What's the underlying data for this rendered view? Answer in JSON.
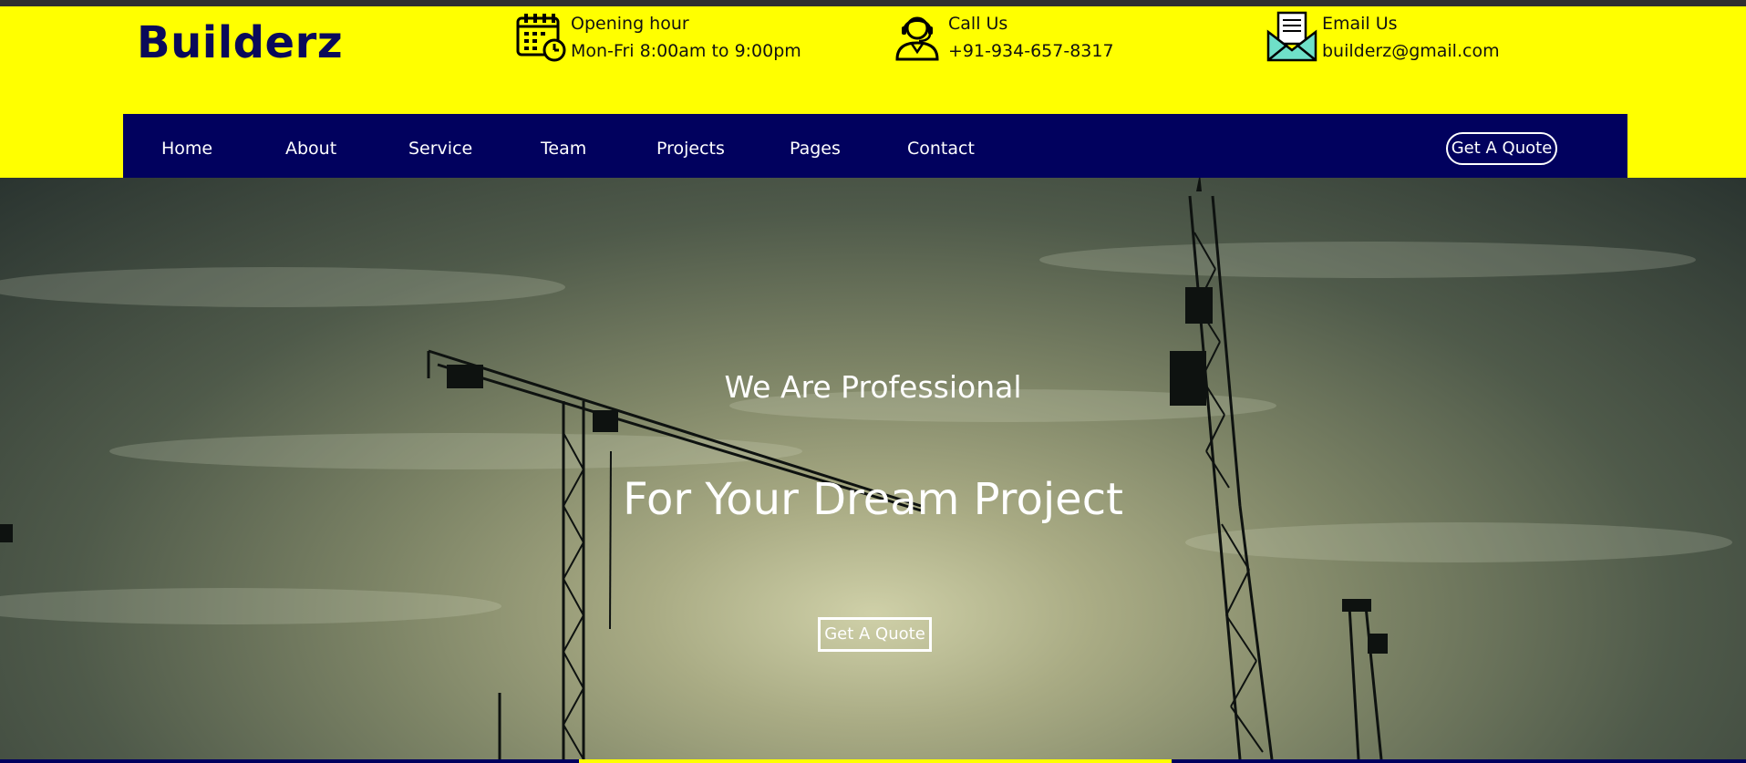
{
  "brand": {
    "name": "Builderz"
  },
  "info": {
    "hours": {
      "title": "Opening hour",
      "value": "Mon-Fri 8:00am to 9:00pm",
      "icon": "calendar-clock-icon"
    },
    "call": {
      "title": "Call Us",
      "value": "+91-934-657-8317",
      "icon": "support-agent-icon"
    },
    "email": {
      "title": "Email Us",
      "value": "builderz@gmail.com",
      "icon": "envelope-icon"
    }
  },
  "nav": {
    "items": [
      "Home",
      "About",
      "Service",
      "Team",
      "Projects",
      "Pages",
      "Contact"
    ],
    "quote_label": "Get A Quote"
  },
  "hero": {
    "subtitle": "We Are Professional",
    "title": "For Your Dream Project",
    "button_label": "Get A Quote"
  },
  "colors": {
    "header_bg": "#ffff00",
    "nav_bg": "#01015e",
    "brand_text": "#0a0a5a",
    "hero_text": "#ffffff"
  }
}
